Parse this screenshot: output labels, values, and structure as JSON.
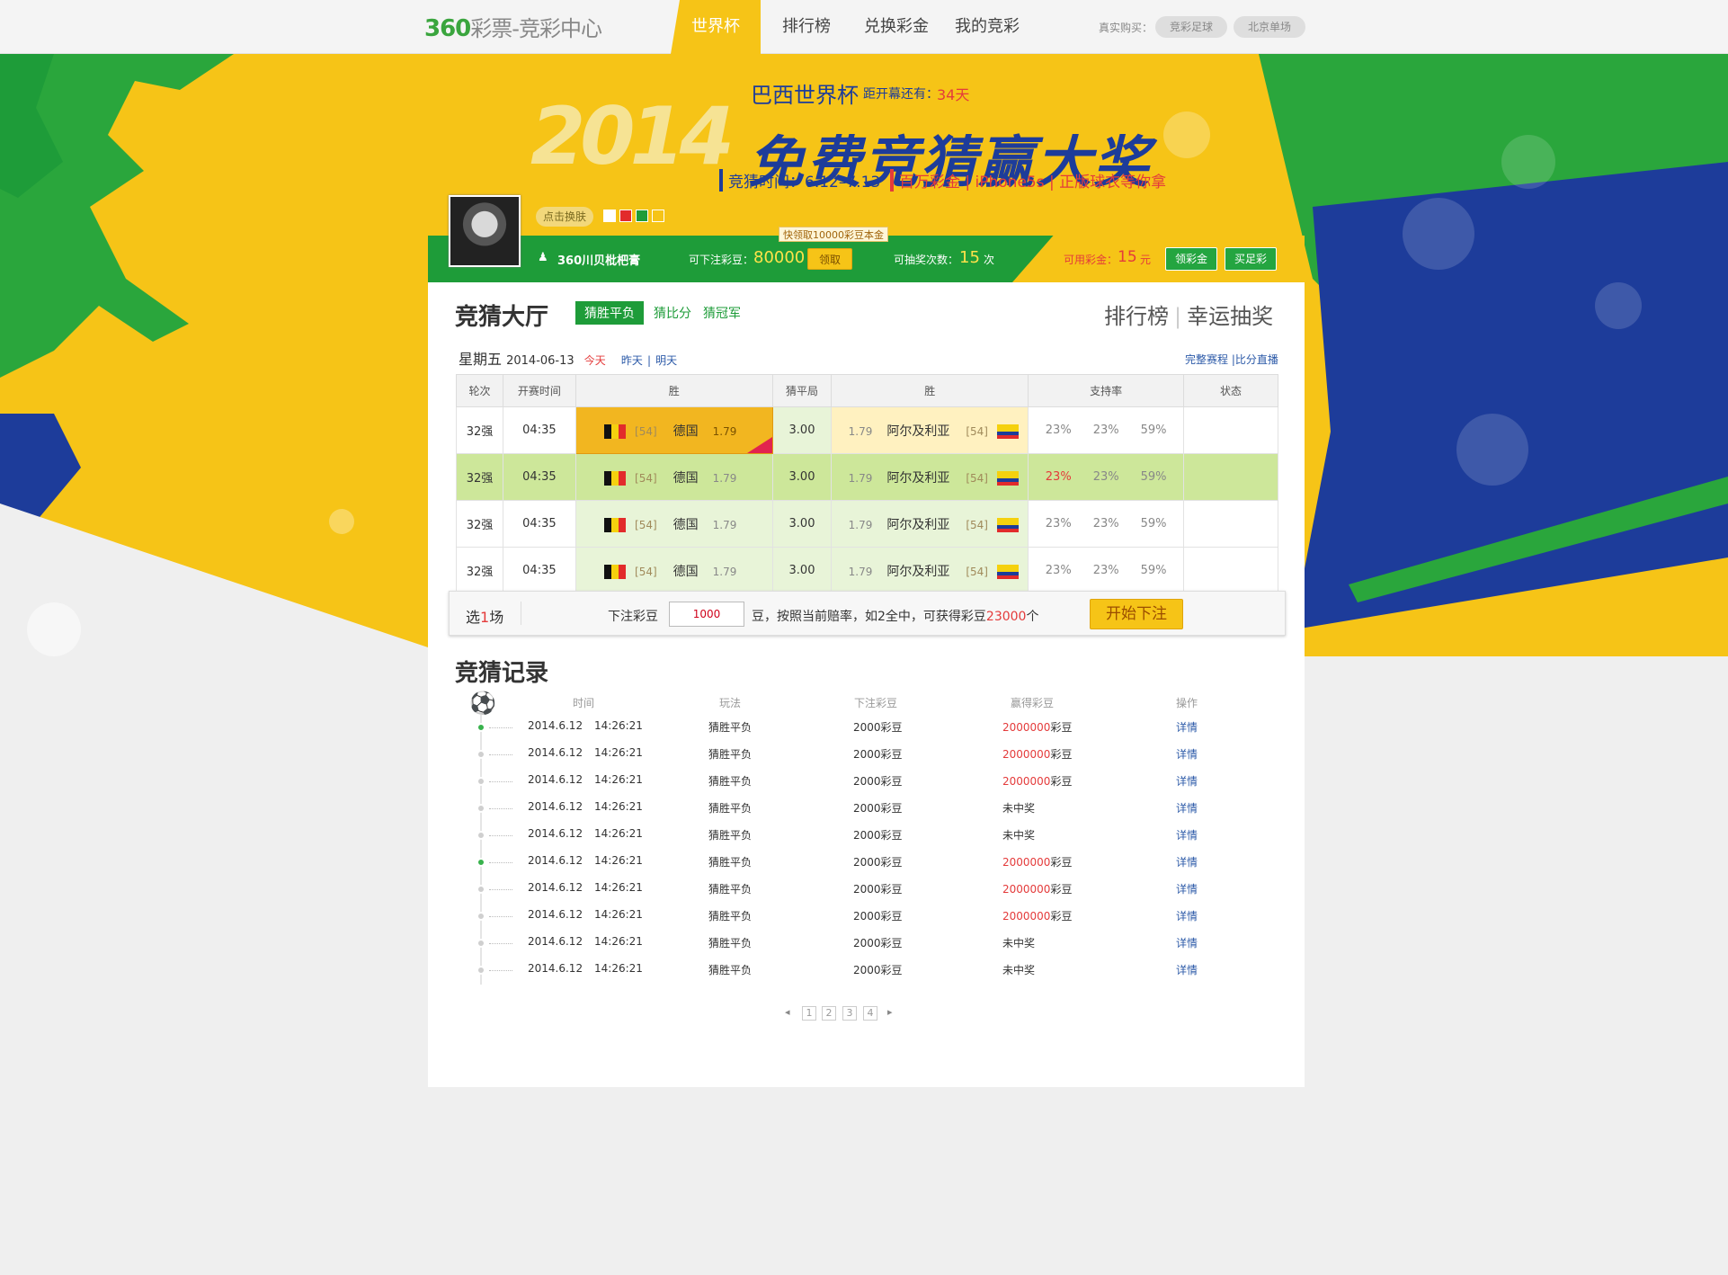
{
  "topbar": {
    "logo_num": "360",
    "logo_rest": "彩票-竞彩中心",
    "nav": [
      "世界杯",
      "排行榜",
      "兑换彩金",
      "我的竞彩"
    ],
    "buy_label": "真实购买：",
    "buy_links": [
      "竞彩足球",
      "北京单场"
    ]
  },
  "banner": {
    "year": "2014",
    "cup": "巴西世界杯",
    "countdown_label": "距开幕还有：",
    "countdown_value": "34天",
    "headline": "免费竞猜赢大奖",
    "time_label": "竞猜时间：6.12–7.13",
    "prizes": "百万彩金 | iPhone5s | 正版球衣等你拿"
  },
  "user": {
    "skin_label": "点击换肤",
    "swatches": [
      "#ffffff",
      "#e22b2b",
      "#1e9c39",
      "#f6c417"
    ],
    "name": "360川贝枇杷膏",
    "bean_label": "可下注彩豆：",
    "bean_value": "80000",
    "claim_tip": "快领取10000彩豆本金",
    "claim_btn": "领取",
    "draw_label": "可抽奖次数：",
    "draw_value": "15",
    "draw_unit": "次",
    "cash_label": "可用彩金：",
    "cash_value": "15",
    "cash_unit": "元",
    "get_cash_btn": "领彩金",
    "buy_lottery_btn": "买足彩"
  },
  "hall": {
    "title": "竞猜大厅",
    "tabs": [
      "猜胜平负",
      "猜比分",
      "猜冠军"
    ],
    "right_links": [
      "排行榜",
      "幸运抽奖"
    ],
    "weekday": "星期五",
    "date": "2014-06-13",
    "today": "今天",
    "yesterday": "昨天",
    "tomorrow": "明天",
    "schedule_link": "完整赛程 |比分直播"
  },
  "match_table": {
    "headers": [
      "轮次",
      "开赛时间",
      "胜",
      "猜平局",
      "胜",
      "支持率",
      "状态"
    ],
    "rows": [
      {
        "round": "32强",
        "time": "04:35",
        "home_rank": "[54]",
        "home": "德国",
        "home_odd": "1.79",
        "draw": "3.00",
        "away_odd": "1.79",
        "away": "阿尔及利亚",
        "away_rank": "[54]",
        "p1": "23%",
        "p2": "23%",
        "p3": "59%"
      },
      {
        "round": "32强",
        "time": "04:35",
        "home_rank": "[54]",
        "home": "德国",
        "home_odd": "1.79",
        "draw": "3.00",
        "away_odd": "1.79",
        "away": "阿尔及利亚",
        "away_rank": "[54]",
        "p1": "23%",
        "p2": "23%",
        "p3": "59%"
      },
      {
        "round": "32强",
        "time": "04:35",
        "home_rank": "[54]",
        "home": "德国",
        "home_odd": "1.79",
        "draw": "3.00",
        "away_odd": "1.79",
        "away": "阿尔及利亚",
        "away_rank": "[54]",
        "p1": "23%",
        "p2": "23%",
        "p3": "59%"
      },
      {
        "round": "32强",
        "time": "04:35",
        "home_rank": "[54]",
        "home": "德国",
        "home_odd": "1.79",
        "draw": "3.00",
        "away_odd": "1.79",
        "away": "阿尔及利亚",
        "away_rank": "[54]",
        "p1": "23%",
        "p2": "23%",
        "p3": "59%"
      }
    ]
  },
  "bet_bar": {
    "select_prefix": "选",
    "select_count": "1",
    "select_suffix": "场",
    "bet_label": "下注彩豆",
    "bet_value": "1000",
    "desc_prefix": "豆，按照当前赔率，如2全中，可获得彩豆",
    "desc_value": "23000",
    "desc_suffix": "个",
    "start_btn": "开始下注"
  },
  "records": {
    "title": "竞猜记录",
    "headers": [
      "时间",
      "玩法",
      "下注彩豆",
      "赢得彩豆",
      "操作"
    ],
    "rows": [
      {
        "date": "2014.6.12",
        "time": "14:26:21",
        "play": "猜胜平负",
        "bet": "2000彩豆",
        "win_num": "2000000",
        "win_unit": "彩豆",
        "op": "详情",
        "on": true
      },
      {
        "date": "2014.6.12",
        "time": "14:26:21",
        "play": "猜胜平负",
        "bet": "2000彩豆",
        "win_num": "2000000",
        "win_unit": "彩豆",
        "op": "详情",
        "on": false
      },
      {
        "date": "2014.6.12",
        "time": "14:26:21",
        "play": "猜胜平负",
        "bet": "2000彩豆",
        "win_num": "2000000",
        "win_unit": "彩豆",
        "op": "详情",
        "on": false
      },
      {
        "date": "2014.6.12",
        "time": "14:26:21",
        "play": "猜胜平负",
        "bet": "2000彩豆",
        "win_num": "",
        "win_unit": "未中奖",
        "op": "详情",
        "on": false
      },
      {
        "date": "2014.6.12",
        "time": "14:26:21",
        "play": "猜胜平负",
        "bet": "2000彩豆",
        "win_num": "",
        "win_unit": "未中奖",
        "op": "详情",
        "on": false
      },
      {
        "date": "2014.6.12",
        "time": "14:26:21",
        "play": "猜胜平负",
        "bet": "2000彩豆",
        "win_num": "2000000",
        "win_unit": "彩豆",
        "op": "详情",
        "on": true
      },
      {
        "date": "2014.6.12",
        "time": "14:26:21",
        "play": "猜胜平负",
        "bet": "2000彩豆",
        "win_num": "2000000",
        "win_unit": "彩豆",
        "op": "详情",
        "on": false
      },
      {
        "date": "2014.6.12",
        "time": "14:26:21",
        "play": "猜胜平负",
        "bet": "2000彩豆",
        "win_num": "2000000",
        "win_unit": "彩豆",
        "op": "详情",
        "on": false
      },
      {
        "date": "2014.6.12",
        "time": "14:26:21",
        "play": "猜胜平负",
        "bet": "2000彩豆",
        "win_num": "",
        "win_unit": "未中奖",
        "op": "详情",
        "on": false
      },
      {
        "date": "2014.6.12",
        "time": "14:26:21",
        "play": "猜胜平负",
        "bet": "2000彩豆",
        "win_num": "",
        "win_unit": "未中奖",
        "op": "详情",
        "on": false
      }
    ]
  },
  "pager": {
    "prev": "◂",
    "pages": [
      "1",
      "2",
      "3",
      "4"
    ],
    "next": "▸"
  }
}
